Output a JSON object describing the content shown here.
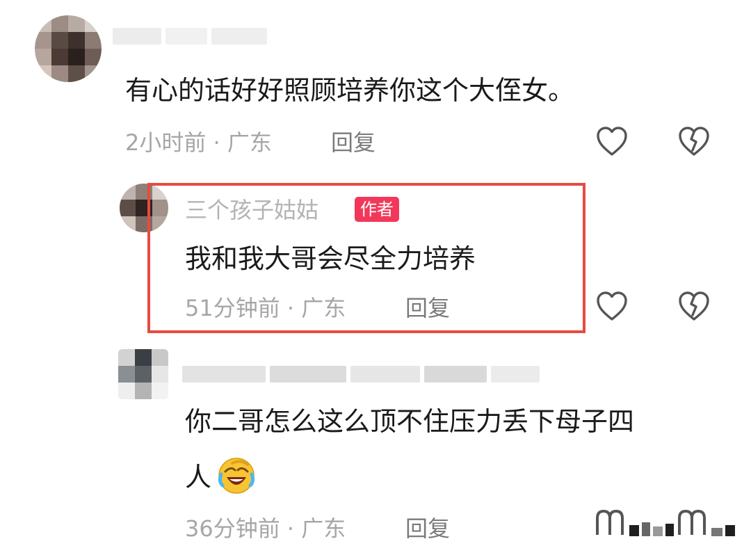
{
  "comments": [
    {
      "text": "有心的话好好照顾培养你这个大侄女。",
      "time": "2小时前",
      "separator": "·",
      "location": "广东",
      "reply_label": "回复",
      "like_icon": "heart-outline-icon",
      "dislike_icon": "broken-heart-icon"
    },
    {
      "username": "三个孩子姑姑",
      "badge": "作者",
      "text": "我和我大哥会尽全力培养",
      "time": "51分钟前",
      "separator": "·",
      "location": "广东",
      "reply_label": "回复",
      "like_icon": "heart-outline-icon",
      "dislike_icon": "broken-heart-icon"
    },
    {
      "text_line1": "你二哥怎么这么顶不住压力丢下母子四",
      "text_line2": "人",
      "emoji": "crying-laughing-emoji",
      "time": "36分钟前",
      "separator": "·",
      "location": "广东",
      "reply_label": "回复"
    }
  ],
  "colors": {
    "highlight_border": "#e84a3f",
    "author_badge": "#f2385a",
    "meta_text": "#a6a6a6",
    "body_text": "#1a1a1a"
  }
}
